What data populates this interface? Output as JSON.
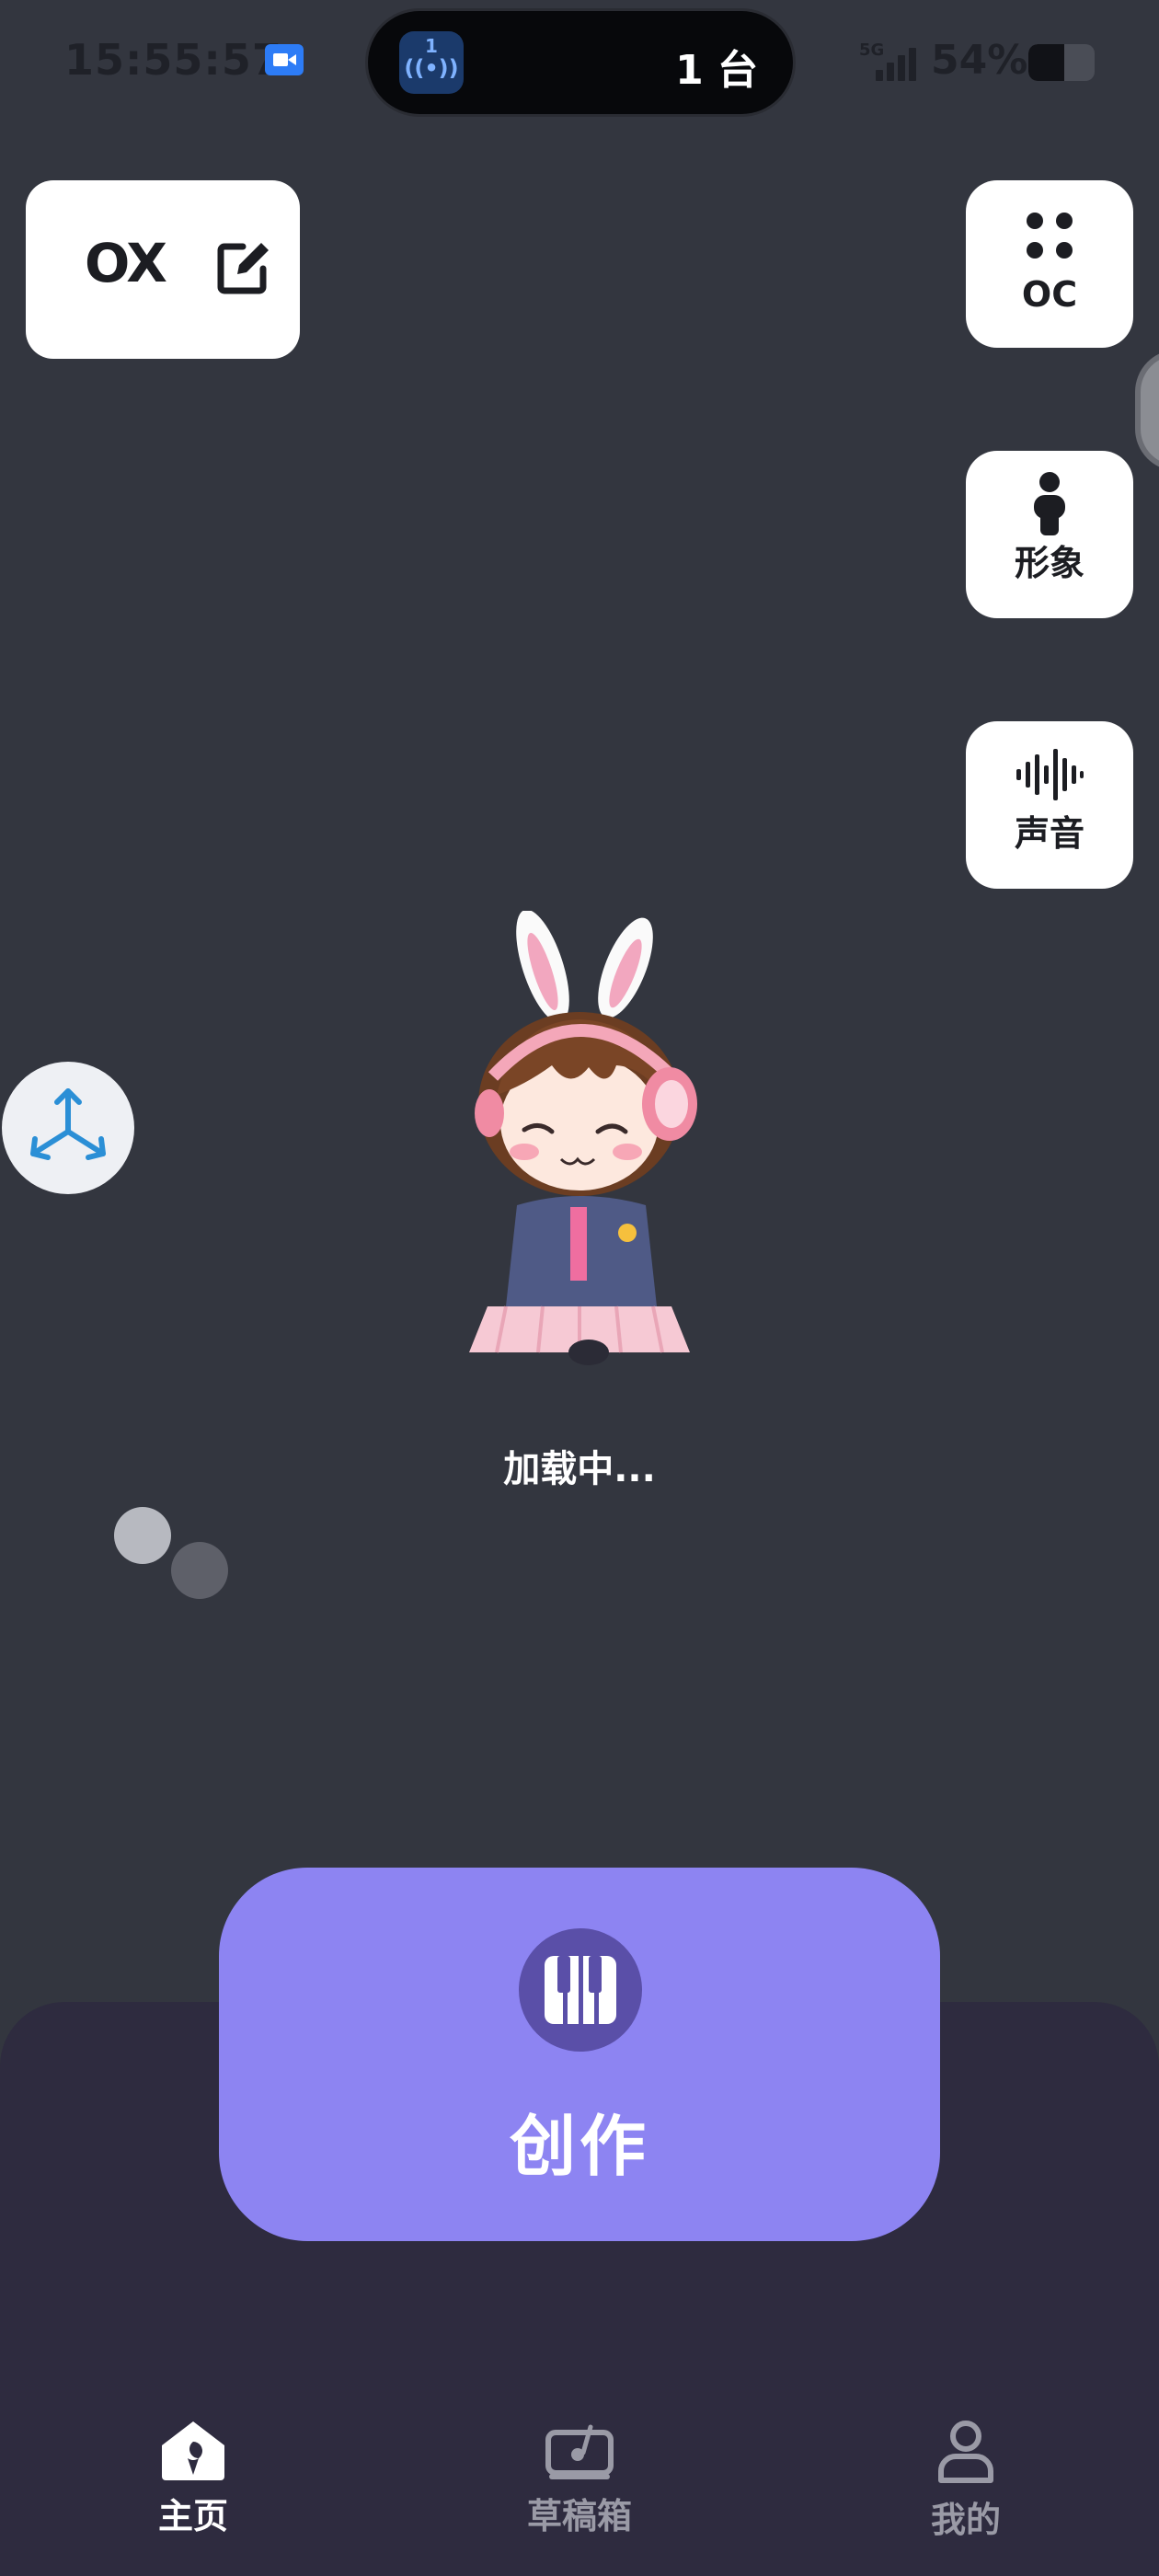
{
  "status_bar": {
    "time": "15:55:57",
    "island_channel": "1",
    "island_count": "1 台",
    "network": "5G",
    "battery_percent": "54%",
    "battery_level": 0.54
  },
  "top_card": {
    "label": "OX",
    "icon": "edit-icon"
  },
  "side_buttons": [
    {
      "label": "OC",
      "icon": "dots-grid-icon"
    },
    {
      "label": "形象",
      "icon": "person-icon"
    },
    {
      "label": "声音",
      "icon": "sound-wave-icon"
    }
  ],
  "float_button": {
    "icon": "share-icon"
  },
  "loading": {
    "text": "加载中..."
  },
  "create_button": {
    "label": "创作",
    "icon": "piano-icon"
  },
  "bottom_nav": [
    {
      "label": "主页",
      "icon": "home-icon",
      "active": true
    },
    {
      "label": "草稿箱",
      "icon": "drafts-icon",
      "active": false
    },
    {
      "label": "我的",
      "icon": "profile-icon",
      "active": false
    }
  ],
  "colors": {
    "background": "#33363f",
    "accent": "#8d84f2",
    "panel": "#2e2b3f"
  }
}
